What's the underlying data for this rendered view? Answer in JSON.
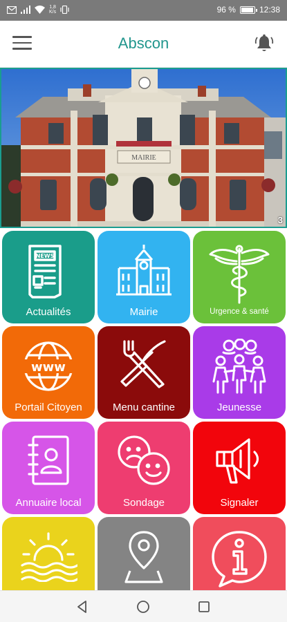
{
  "status_bar": {
    "speed_top": "1,8",
    "speed_bottom": "K/s",
    "battery_percent": "96 %",
    "time": "12:38"
  },
  "app_bar": {
    "title": "Abscon",
    "menu_icon": "hamburger-menu-icon",
    "notification_icon": "bell-icon"
  },
  "hero": {
    "slide_counter": "3",
    "building_plaque": "MAIRIE"
  },
  "colors": {
    "title": "#21968d",
    "hero_border": "#1a9d90"
  },
  "tiles": [
    {
      "label": "Actualités",
      "icon": "newspaper-icon",
      "color": "#1a9d8a"
    },
    {
      "label": "Mairie",
      "icon": "town-hall-icon",
      "color": "#32b3f0"
    },
    {
      "label": "Urgence & santé",
      "icon": "caduceus-icon",
      "color": "#6bc13a"
    },
    {
      "label": "Portail Citoyen",
      "icon": "globe-www-icon",
      "color": "#f26a08"
    },
    {
      "label": "Menu cantine",
      "icon": "fork-knife-icon",
      "color": "#8b0b0b"
    },
    {
      "label": "Jeunesse",
      "icon": "children-group-icon",
      "color": "#a93be8"
    },
    {
      "label": "Annuaire local",
      "icon": "contact-book-icon",
      "color": "#d655e8"
    },
    {
      "label": "Sondage",
      "icon": "smiley-faces-icon",
      "color": "#ee3d70"
    },
    {
      "label": "Signaler",
      "icon": "megaphone-icon",
      "color": "#f2050c"
    },
    {
      "label": "",
      "icon": "sun-waves-icon",
      "color": "#ead31c"
    },
    {
      "label": "",
      "icon": "map-pin-icon",
      "color": "#848484"
    },
    {
      "label": "",
      "icon": "info-bubble-icon",
      "color": "#f04d5c"
    }
  ],
  "nav_bar": {
    "back": "back-triangle-icon",
    "home": "home-circle-icon",
    "recents": "recents-square-icon"
  }
}
